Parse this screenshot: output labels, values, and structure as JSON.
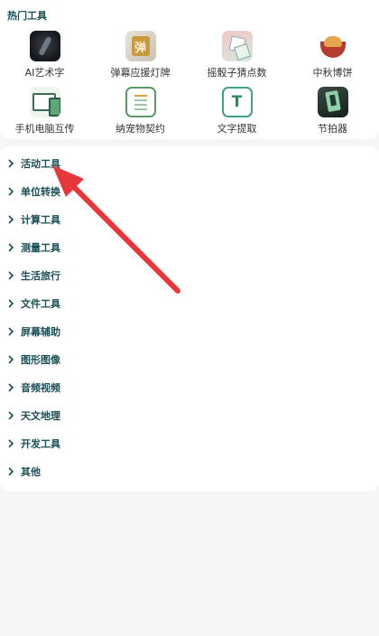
{
  "hot_tools": {
    "title": "热门工具",
    "items": [
      {
        "label": "AI艺术字",
        "icon": "ai-art-icon"
      },
      {
        "label": "弹幕应援灯牌",
        "icon": "danmu-icon",
        "glyph": "弹"
      },
      {
        "label": "摇骰子猜点数",
        "icon": "dice-icon"
      },
      {
        "label": "中秋博饼",
        "icon": "mooncake-bowl-icon"
      },
      {
        "label": "手机电脑互传",
        "icon": "phone-pc-transfer-icon"
      },
      {
        "label": "纳宠物契约",
        "icon": "contract-icon"
      },
      {
        "label": "文字提取",
        "icon": "text-extract-icon",
        "glyph": "T"
      },
      {
        "label": "节拍器",
        "icon": "metronome-icon"
      }
    ]
  },
  "categories": [
    {
      "label": "活动工具"
    },
    {
      "label": "单位转换"
    },
    {
      "label": "计算工具"
    },
    {
      "label": "测量工具"
    },
    {
      "label": "生活旅行"
    },
    {
      "label": "文件工具"
    },
    {
      "label": "屏幕辅助"
    },
    {
      "label": "图形图像"
    },
    {
      "label": "音频视频"
    },
    {
      "label": "天文地理"
    },
    {
      "label": "开发工具"
    },
    {
      "label": "其他"
    }
  ],
  "colors": {
    "category_text": "#1c4f57",
    "annotation_arrow": "#e8373a",
    "background": "#f5f6f8"
  }
}
